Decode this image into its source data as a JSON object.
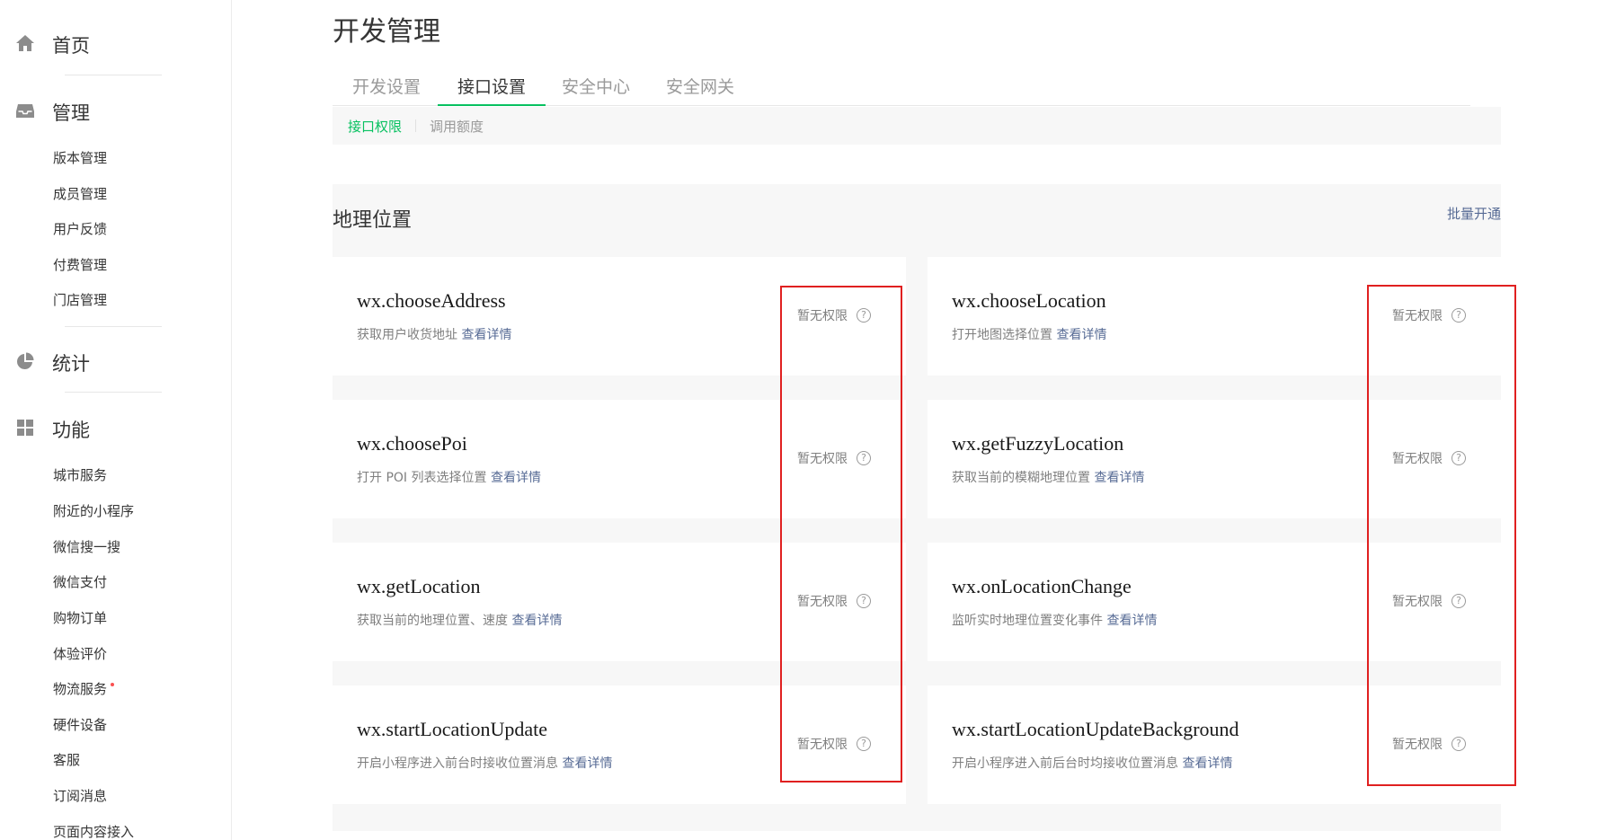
{
  "sidebar": {
    "home": "首页",
    "manage": "管理",
    "manage_items": [
      "版本管理",
      "成员管理",
      "用户反馈",
      "付费管理",
      "门店管理"
    ],
    "stats": "统计",
    "features": "功能",
    "feature_items": [
      "城市服务",
      "附近的小程序",
      "微信搜一搜",
      "微信支付",
      "购物订单",
      "体验评价",
      "物流服务",
      "硬件设备",
      "客服",
      "订阅消息",
      "页面内容接入"
    ]
  },
  "page_title": "开发管理",
  "tabs": [
    "开发设置",
    "接口设置",
    "安全中心",
    "安全网关"
  ],
  "active_tab": "接口设置",
  "subtabs": [
    "接口权限",
    "调用额度"
  ],
  "section": {
    "title": "地理位置",
    "batch_action": "批量开通"
  },
  "detail_link": "查看详情",
  "permission_status": "暂无权限",
  "help_glyph": "?",
  "apis": [
    {
      "name": "wx.chooseAddress",
      "desc": "获取用户收货地址"
    },
    {
      "name": "wx.chooseLocation",
      "desc": "打开地图选择位置"
    },
    {
      "name": "wx.choosePoi",
      "desc": "打开 POI 列表选择位置"
    },
    {
      "name": "wx.getFuzzyLocation",
      "desc": "获取当前的模糊地理位置"
    },
    {
      "name": "wx.getLocation",
      "desc": "获取当前的地理位置、速度"
    },
    {
      "name": "wx.onLocationChange",
      "desc": "监听实时地理位置变化事件"
    },
    {
      "name": "wx.startLocationUpdate",
      "desc": "开启小程序进入前台时接收位置消息"
    },
    {
      "name": "wx.startLocationUpdateBackground",
      "desc": "开启小程序进入前后台时均接收位置消息"
    }
  ],
  "colors": {
    "accent": "#07c160",
    "link": "#576b95",
    "highlight_box": "#e02020"
  }
}
